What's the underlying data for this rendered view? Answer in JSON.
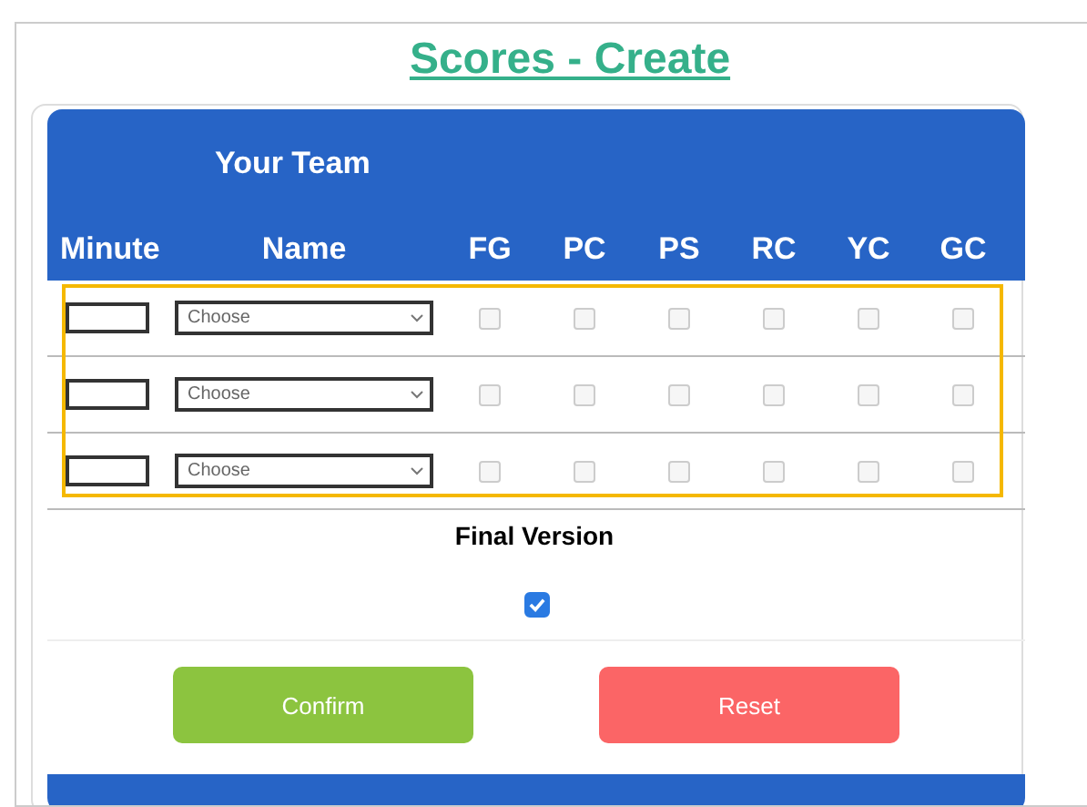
{
  "title": "Scores - Create",
  "team_heading": "Your Team",
  "columns": [
    {
      "label": "Minute",
      "kind": "field"
    },
    {
      "label": "Name",
      "kind": "select"
    },
    {
      "label": "FG",
      "kind": "check"
    },
    {
      "label": "PC",
      "kind": "check"
    },
    {
      "label": "PS",
      "kind": "check"
    },
    {
      "label": "RC",
      "kind": "check"
    },
    {
      "label": "YC",
      "kind": "check"
    },
    {
      "label": "GC",
      "kind": "check"
    }
  ],
  "rows": [
    {
      "name_placeholder": "Choose",
      "checks": [
        false,
        false,
        false,
        false,
        false,
        false
      ]
    },
    {
      "name_placeholder": "Choose",
      "checks": [
        false,
        false,
        false,
        false,
        false,
        false
      ]
    },
    {
      "name_placeholder": "Choose",
      "checks": [
        false,
        false,
        false,
        false,
        false,
        false
      ]
    }
  ],
  "highlighted": true,
  "final_version": {
    "label": "Final Version",
    "checked": true
  },
  "buttons": [
    {
      "label": "Confirm",
      "kind": "confirm"
    },
    {
      "label": "Reset",
      "kind": "reset"
    }
  ]
}
